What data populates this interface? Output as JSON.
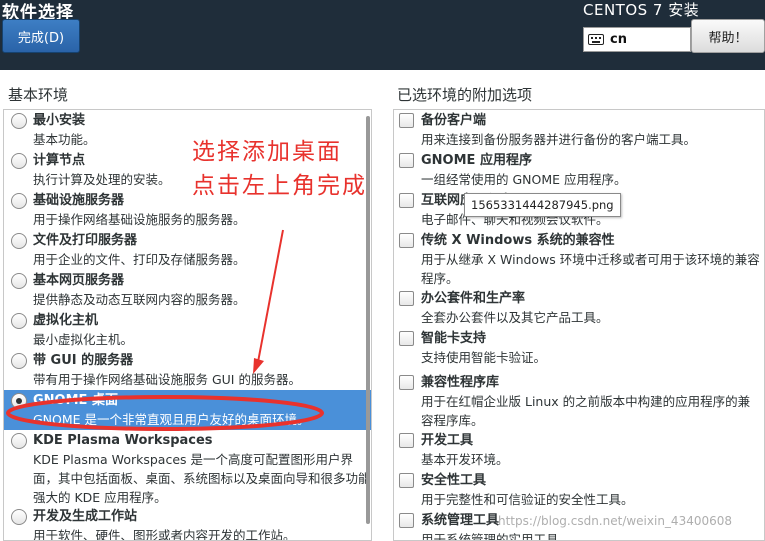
{
  "header": {
    "page_title": "软件选择",
    "done_label": "完成(D)",
    "install_title": "CENTOS 7 安装",
    "keyboard_layout": "cn",
    "help_label": "帮助！",
    "background_color": "#1f2d3a"
  },
  "base_environment": {
    "title": "基本环境",
    "items": [
      {
        "title": "最小安装",
        "desc": "基本功能。",
        "checked": false
      },
      {
        "title": "计算节点",
        "desc": "执行计算及处理的安装。",
        "checked": false
      },
      {
        "title": "基础设施服务器",
        "desc": "用于操作网络基础设施服务的服务器。",
        "checked": false
      },
      {
        "title": "文件及打印服务器",
        "desc": "用于企业的文件、打印及存储服务器。",
        "checked": false
      },
      {
        "title": "基本网页服务器",
        "desc": "提供静态及动态互联网内容的服务器。",
        "checked": false
      },
      {
        "title": "虚拟化主机",
        "desc": "最小虚拟化主机。",
        "checked": false
      },
      {
        "title": "带 GUI 的服务器",
        "desc": "带有用于操作网络基础设施服务 GUI 的服务器。",
        "checked": false
      },
      {
        "title": "GNOME 桌面",
        "desc": "GNOME 是一个非常直观且用户友好的桌面环境。",
        "checked": true
      },
      {
        "title": "KDE Plasma Workspaces",
        "desc": "KDE Plasma Workspaces 是一个高度可配置图形用户界面，其中包括面板、桌面、系统图标以及桌面向导和很多功能强大的 KDE 应用程序。",
        "checked": false
      },
      {
        "title": "开发及生成工作站",
        "desc": "用于软件、硬件、图形或者内容开发的工作站。",
        "checked": false
      }
    ]
  },
  "addons": {
    "title": "已选环境的附加选项",
    "items": [
      {
        "title": "备份客户端",
        "desc": "用来连接到备份服务器并进行备份的客户端工具。"
      },
      {
        "title": "GNOME 应用程序",
        "desc": "一组经常使用的 GNOME 应用程序。"
      },
      {
        "title": "互联网应用程序",
        "desc": "电子邮件、聊天和视频会议软件。"
      },
      {
        "title": "传统 X Windows 系统的兼容性",
        "desc": "用于从继承 X Windows 环境中迁移或者可用于该环境的兼容程序。"
      },
      {
        "title": "办公套件和生产率",
        "desc": "全套办公套件以及其它产品工具。"
      },
      {
        "title": "智能卡支持",
        "desc": "支持使用智能卡验证。"
      },
      {
        "title": "兼容性程序库",
        "desc": "用于在红帽企业版 Linux 的之前版本中构建的应用程序的兼容程序库。"
      },
      {
        "title": "开发工具",
        "desc": "基本开发环境。"
      },
      {
        "title": "安全性工具",
        "desc": "用于完整性和可信验证的安全性工具。"
      },
      {
        "title": "系统管理工具",
        "desc": "用于系统管理的实用工具。"
      }
    ]
  },
  "tooltip": "1565331444287945.png",
  "annotation": {
    "line1": "选择添加桌面",
    "line2": "点击左上角完成",
    "color": "#e8322d"
  },
  "watermark": "https://blog.csdn.net/weixin_43400608",
  "accent_color": "#4a90d9"
}
